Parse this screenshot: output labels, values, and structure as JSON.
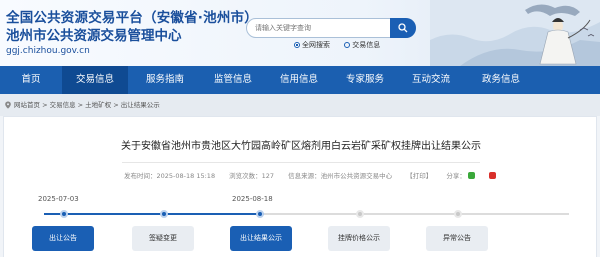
{
  "header": {
    "title_line1": "全国公共资源交易平台（安徽省·池州市）",
    "title_line2": "池州市公共资源交易管理中心",
    "url": "ggj.chizhou.gov.cn"
  },
  "search": {
    "placeholder": "请输入关键字查询",
    "scopes": [
      "全网搜索",
      "交易信息"
    ],
    "selected_scope": "全网搜索"
  },
  "nav": {
    "items": [
      "首页",
      "交易信息",
      "服务指南",
      "监管信息",
      "信用信息",
      "专家服务",
      "互动交流",
      "政务信息"
    ],
    "active": "交易信息"
  },
  "breadcrumb": {
    "path": "网站首页 > 交易信息 > 土地矿权 > 出让结果公示"
  },
  "article": {
    "title": "关于安徽省池州市贵池区大竹园高岭矿区熔剂用白云岩矿采矿权挂牌出让结果公示",
    "publish_time": "发布时间：2025-08-18 15:18",
    "view_count": "浏览次数：127",
    "source": "信息来源：池州市公共资源交易中心",
    "print_label": "【打印】",
    "share_label": "分享："
  },
  "timeline": {
    "dates": [
      "2025-07-03",
      "2025-08-18"
    ],
    "steps": [
      "出让公告",
      "签疑变更",
      "出让结果公示",
      "挂牌价格公示",
      "异常公告"
    ],
    "active_step": "出让结果公示"
  },
  "colors": {
    "primary": "#1b5fb0",
    "nav_active": "#0f4a92",
    "share_weibo": "#d9302b",
    "share_wechat": "#3aa83a"
  }
}
